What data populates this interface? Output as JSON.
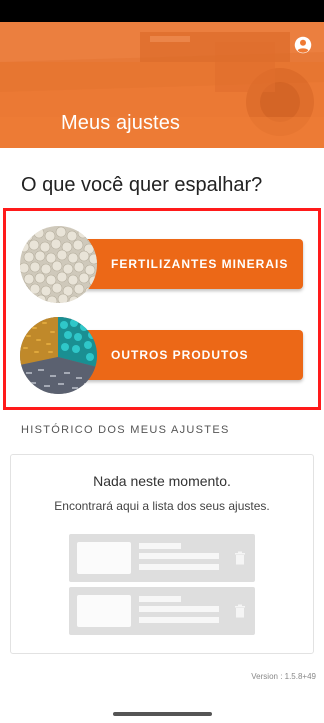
{
  "header": {
    "title": "Meus ajustes",
    "account_icon": "account-circle-icon",
    "color": "#ef7a33"
  },
  "main": {
    "question": "O que você quer espalhar?",
    "products": [
      {
        "label": "FERTILIZANTES MINERAIS",
        "image": "fertilizer-granules"
      },
      {
        "label": "OUTROS PRODUTOS",
        "image": "mixed-products"
      }
    ],
    "button_color": "#ec6817",
    "highlight_color": "#ff1a1a"
  },
  "history": {
    "title": "HISTÓRICO DOS MEUS AJUSTES",
    "empty_title": "Nada neste momento.",
    "empty_subtitle": "Encontrará aqui a lista dos seus ajustes.",
    "placeholder_icon": "trash-icon"
  },
  "footer": {
    "version": "Version :  1.5.8+49"
  }
}
